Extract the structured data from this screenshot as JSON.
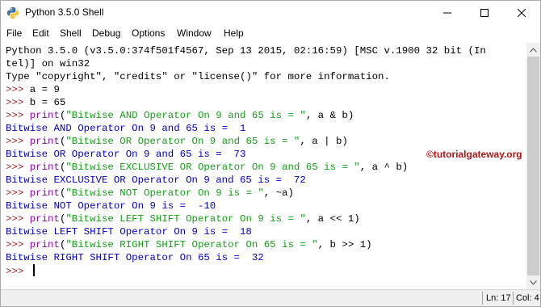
{
  "window": {
    "title": "Python 3.5.0 Shell"
  },
  "menu": [
    "File",
    "Edit",
    "Shell",
    "Debug",
    "Options",
    "Window",
    "Help"
  ],
  "shell": {
    "banner1": "Python 3.5.0 (v3.5.0:374f501f4567, Sep 13 2015, 02:16:59) [MSC v.1900 32 bit (In",
    "banner2": "tel)] on win32",
    "banner3": "Type \"copyright\", \"credits\" or \"license()\" for more information.",
    "prompt": ">>> ",
    "entries": [
      {
        "code": "a = 9"
      },
      {
        "code": "b = 65"
      },
      {
        "fn": "print",
        "str": "\"Bitwise AND Operator On 9 and 65 is = \"",
        "tail": ", a & b)",
        "output": "Bitwise AND Operator On 9 and 65 is =  1"
      },
      {
        "fn": "print",
        "str": "\"Bitwise OR Operator On 9 and 65 is = \"",
        "tail": ", a | b)",
        "output": "Bitwise OR Operator On 9 and 65 is =  73"
      },
      {
        "fn": "print",
        "str": "\"Bitwise EXCLUSIVE OR Operator On 9 and 65 is = \"",
        "tail": ", a ^ b)",
        "output": "Bitwise EXCLUSIVE OR Operator On 9 and 65 is =  72"
      },
      {
        "fn": "print",
        "str": "\"Bitwise NOT Operator On 9 is = \"",
        "tail": ", ~a)",
        "output": "Bitwise NOT Operator On 9 is =  -10"
      },
      {
        "fn": "print",
        "str": "\"Bitwise LEFT SHIFT Operator On 9 is = \"",
        "tail": ", a << 1)",
        "output": "Bitwise LEFT SHIFT Operator On 9 is =  18"
      },
      {
        "fn": "print",
        "str": "\"Bitwise RIGHT SHIFT Operator On 65 is = \"",
        "tail": ", b >> 1)",
        "output": "Bitwise RIGHT SHIFT Operator On 65 is =  32"
      }
    ],
    "open_paren": "("
  },
  "watermark": "©tutorialgateway.org",
  "status": {
    "line": "Ln: 17",
    "col": "Col: 4"
  },
  "colors": {
    "prompt": "#9b1b1b",
    "builtin": "#8a0aa8",
    "string": "#17a018",
    "output": "#0000cc",
    "watermark": "#b01717"
  },
  "icons": {
    "app": "python-icon",
    "minimize": "minimize-icon",
    "maximize": "maximize-icon",
    "close": "close-icon",
    "scroll_up": "scroll-up-arrow-icon",
    "scroll_down": "scroll-down-arrow-icon"
  }
}
